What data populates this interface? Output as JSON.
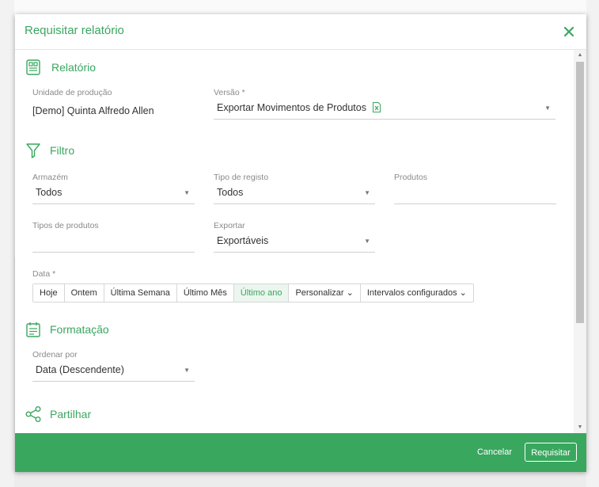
{
  "dialog": {
    "title": "Requisitar relatório"
  },
  "sections": {
    "report": {
      "title": "Relatório",
      "unit_label": "Unidade de produção",
      "unit_value": "[Demo] Quinta Alfredo Allen",
      "version_label": "Versão *",
      "version_value": "Exportar Movimentos de Produtos"
    },
    "filter": {
      "title": "Filtro",
      "warehouse_label": "Armazém",
      "warehouse_value": "Todos",
      "record_type_label": "Tipo de registo",
      "record_type_value": "Todos",
      "products_label": "Produtos",
      "products_value": "",
      "product_types_label": "Tipos de produtos",
      "product_types_value": "",
      "export_label": "Exportar",
      "export_value": "Exportáveis",
      "date_label": "Data *",
      "date_options": [
        "Hoje",
        "Ontem",
        "Última Semana",
        "Último Mês",
        "Último ano",
        "Personalizar ⌄",
        "Intervalos configurados ⌄"
      ],
      "date_selected": "Último ano"
    },
    "formatting": {
      "title": "Formatação",
      "order_label": "Ordenar por",
      "order_value": "Data (Descendente)"
    },
    "share": {
      "title": "Partilhar"
    }
  },
  "footer": {
    "cancel_label": "Cancelar",
    "submit_label": "Requisitar"
  },
  "colors": {
    "accent": "#3aa75f"
  }
}
